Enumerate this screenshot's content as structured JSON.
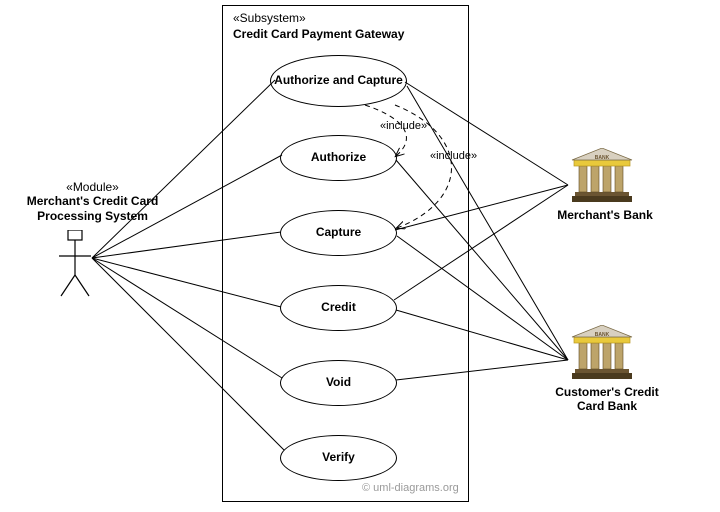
{
  "actors": {
    "merchant_system": {
      "stereotype": "«Module»",
      "name_line1": "Merchant's Credit Card",
      "name_line2": "Processing System"
    },
    "merchant_bank": {
      "name": "Merchant's Bank"
    },
    "customer_bank": {
      "name_line1": "Customer's Credit",
      "name_line2": "Card Bank"
    }
  },
  "subsystem": {
    "stereotype": "«Subsystem»",
    "name": "Credit Card Payment Gateway"
  },
  "usecases": {
    "auth_capture": "Authorize and Capture",
    "authorize": "Authorize",
    "capture": "Capture",
    "credit": "Credit",
    "void": "Void",
    "verify": "Verify"
  },
  "labels": {
    "include1": "«include»",
    "include2": "«include»"
  },
  "copyright": "© uml-diagrams.org",
  "chart_data": {
    "type": "uml-use-case",
    "subsystem": "Credit Card Payment Gateway",
    "actors": [
      "Merchant's Credit Card Processing System",
      "Merchant's Bank",
      "Customer's Credit Card Bank"
    ],
    "use_cases": [
      "Authorize and Capture",
      "Authorize",
      "Capture",
      "Credit",
      "Void",
      "Verify"
    ],
    "associations": [
      [
        "Merchant's Credit Card Processing System",
        "Authorize and Capture"
      ],
      [
        "Merchant's Credit Card Processing System",
        "Authorize"
      ],
      [
        "Merchant's Credit Card Processing System",
        "Capture"
      ],
      [
        "Merchant's Credit Card Processing System",
        "Credit"
      ],
      [
        "Merchant's Credit Card Processing System",
        "Void"
      ],
      [
        "Merchant's Credit Card Processing System",
        "Verify"
      ],
      [
        "Merchant's Bank",
        "Authorize and Capture"
      ],
      [
        "Merchant's Bank",
        "Capture"
      ],
      [
        "Merchant's Bank",
        "Credit"
      ],
      [
        "Customer's Credit Card Bank",
        "Authorize and Capture"
      ],
      [
        "Customer's Credit Card Bank",
        "Authorize"
      ],
      [
        "Customer's Credit Card Bank",
        "Capture"
      ],
      [
        "Customer's Credit Card Bank",
        "Credit"
      ],
      [
        "Customer's Credit Card Bank",
        "Void"
      ]
    ],
    "include": [
      [
        "Authorize and Capture",
        "Authorize"
      ],
      [
        "Authorize and Capture",
        "Capture"
      ]
    ]
  }
}
